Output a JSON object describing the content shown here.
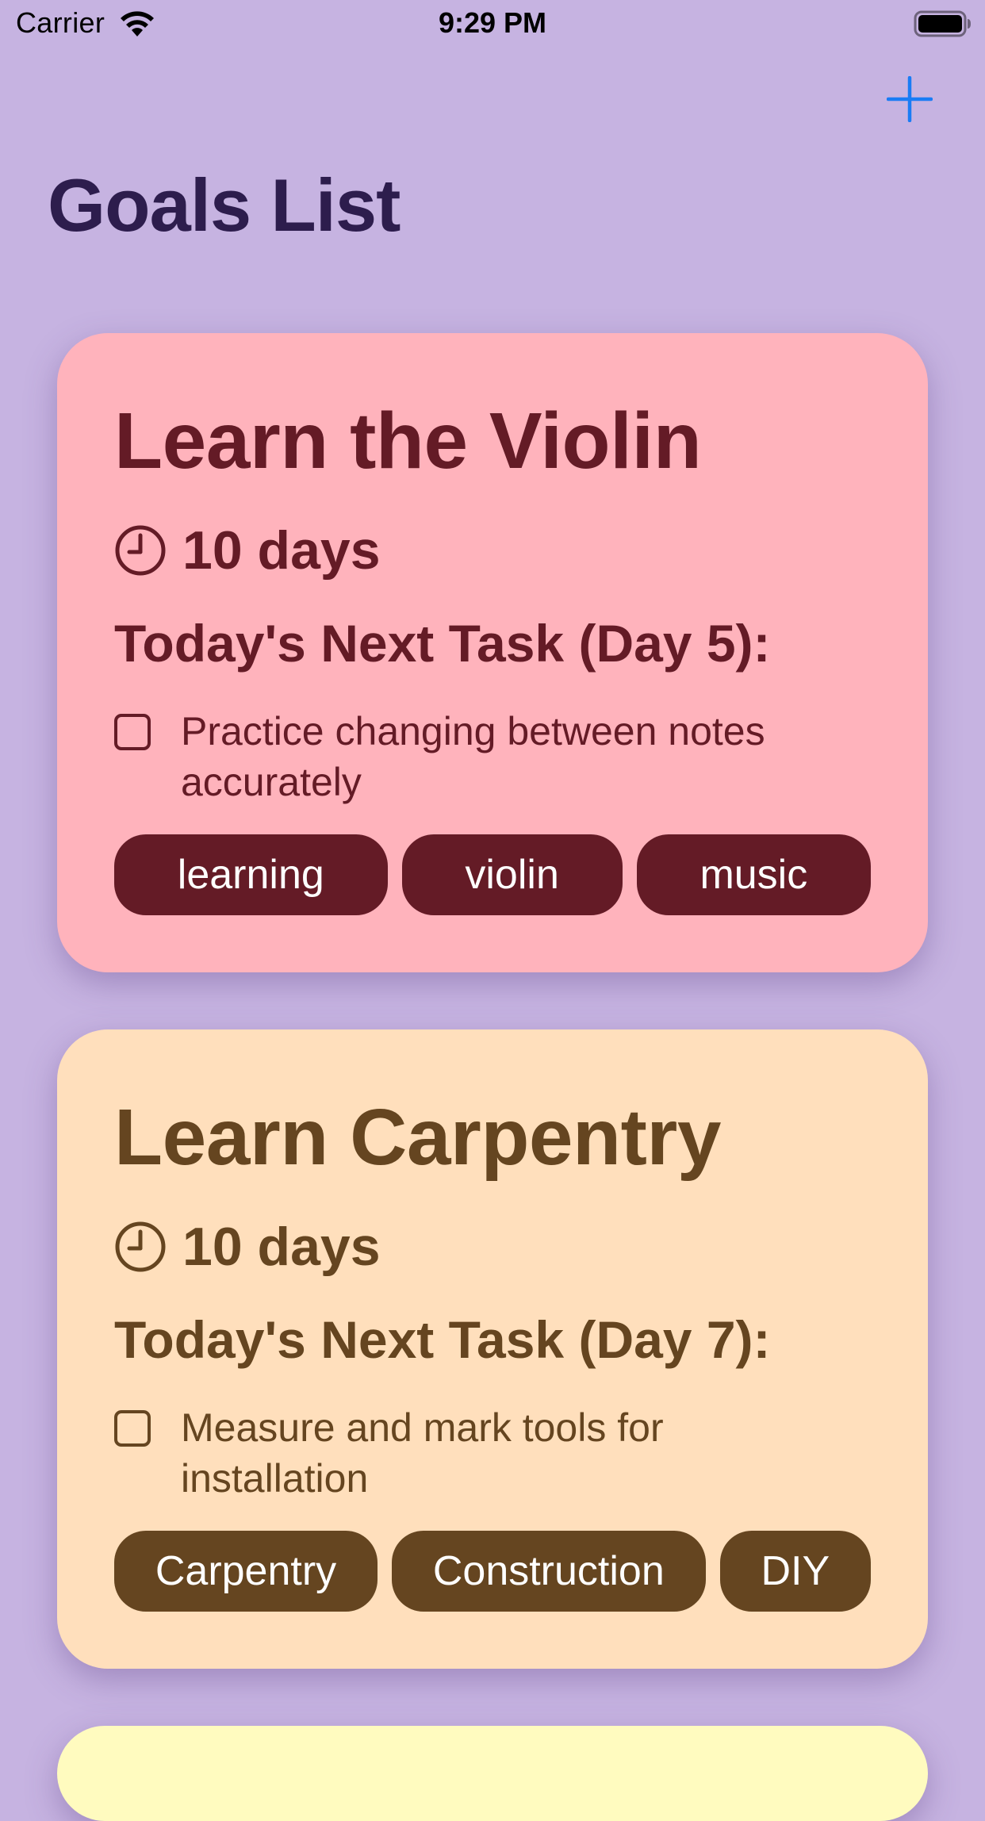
{
  "status_bar": {
    "carrier": "Carrier",
    "time": "9:29 PM",
    "wifi_icon": "wifi-icon",
    "battery_icon": "battery-icon"
  },
  "nav": {
    "title": "Goals List",
    "add_icon": "plus-icon",
    "accent_color": "#1a7cf5"
  },
  "background_color": "#c6b3e1",
  "goals": [
    {
      "title": "Learn the Violin",
      "duration": "10 days",
      "next_task_heading": "Today's Next Task (Day 5):",
      "task": "Practice changing between notes accurately",
      "task_done": false,
      "tags": [
        "learning",
        "violin",
        "music"
      ],
      "card_color": "#ffb3bc",
      "text_color": "#641b26"
    },
    {
      "title": "Learn Carpentry",
      "duration": "10 days",
      "next_task_heading": "Today's Next Task (Day 7):",
      "task": "Measure and mark tools for installation",
      "task_done": false,
      "tags": [
        "Carpentry",
        "Construction",
        "DIY"
      ],
      "card_color": "#ffdfbc",
      "text_color": "#654520"
    },
    {
      "card_color": "#fffbbf"
    }
  ]
}
